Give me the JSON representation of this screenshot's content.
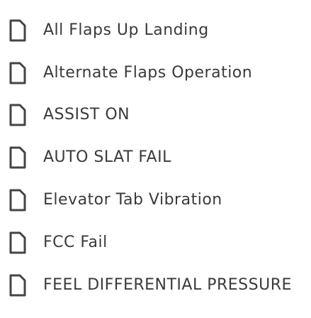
{
  "list": {
    "items": [
      {
        "label": "All Flaps Up Landing",
        "icon": "document-icon"
      },
      {
        "label": "Alternate Flaps Operation",
        "icon": "document-icon"
      },
      {
        "label": "ASSIST ON",
        "icon": "document-icon"
      },
      {
        "label": "AUTO SLAT FAIL",
        "icon": "document-icon"
      },
      {
        "label": "Elevator Tab Vibration",
        "icon": "document-icon"
      },
      {
        "label": "FCC Fail",
        "icon": "document-icon"
      },
      {
        "label": "FEEL DIFFERENTIAL PRESSURE",
        "icon": "document-icon"
      }
    ]
  },
  "colors": {
    "text": "#3a3a3a",
    "icon_stroke": "#444444",
    "background": "#ffffff"
  }
}
